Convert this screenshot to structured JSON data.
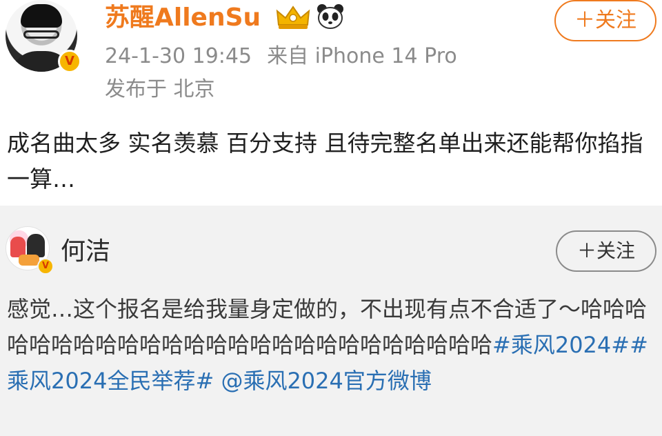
{
  "post": {
    "username": "苏醒AllenSu",
    "verified_badge": "V",
    "badges": [
      "crown-level-icon",
      "panda-icon"
    ],
    "timestamp": "24-1-30 19:45",
    "source": "来自 iPhone 14 Pro",
    "location": "发布于 北京",
    "follow_label": "＋关注",
    "text": "成名曲太多 实名羡慕 百分支持 且待完整名单出来还能帮你掐指一算…"
  },
  "repost": {
    "username": "何洁",
    "verified_badge": "V",
    "follow_label": "＋关注",
    "text_plain": "感觉…这个报名是给我量身定做的，不出现有点不合适了～哈哈哈哈哈哈哈哈哈哈哈哈哈哈哈哈哈哈哈哈哈哈哈哈哈",
    "topic1": "#乘风2024#",
    "topic2": "#乘风2024全民举荐#",
    "mention": " @乘风2024官方微博"
  },
  "colors": {
    "username_orange": "#ef7a1e",
    "meta_gray": "#8b8b8b",
    "topic_blue": "#2a6fb3",
    "repost_bg": "#f2f2f2"
  }
}
